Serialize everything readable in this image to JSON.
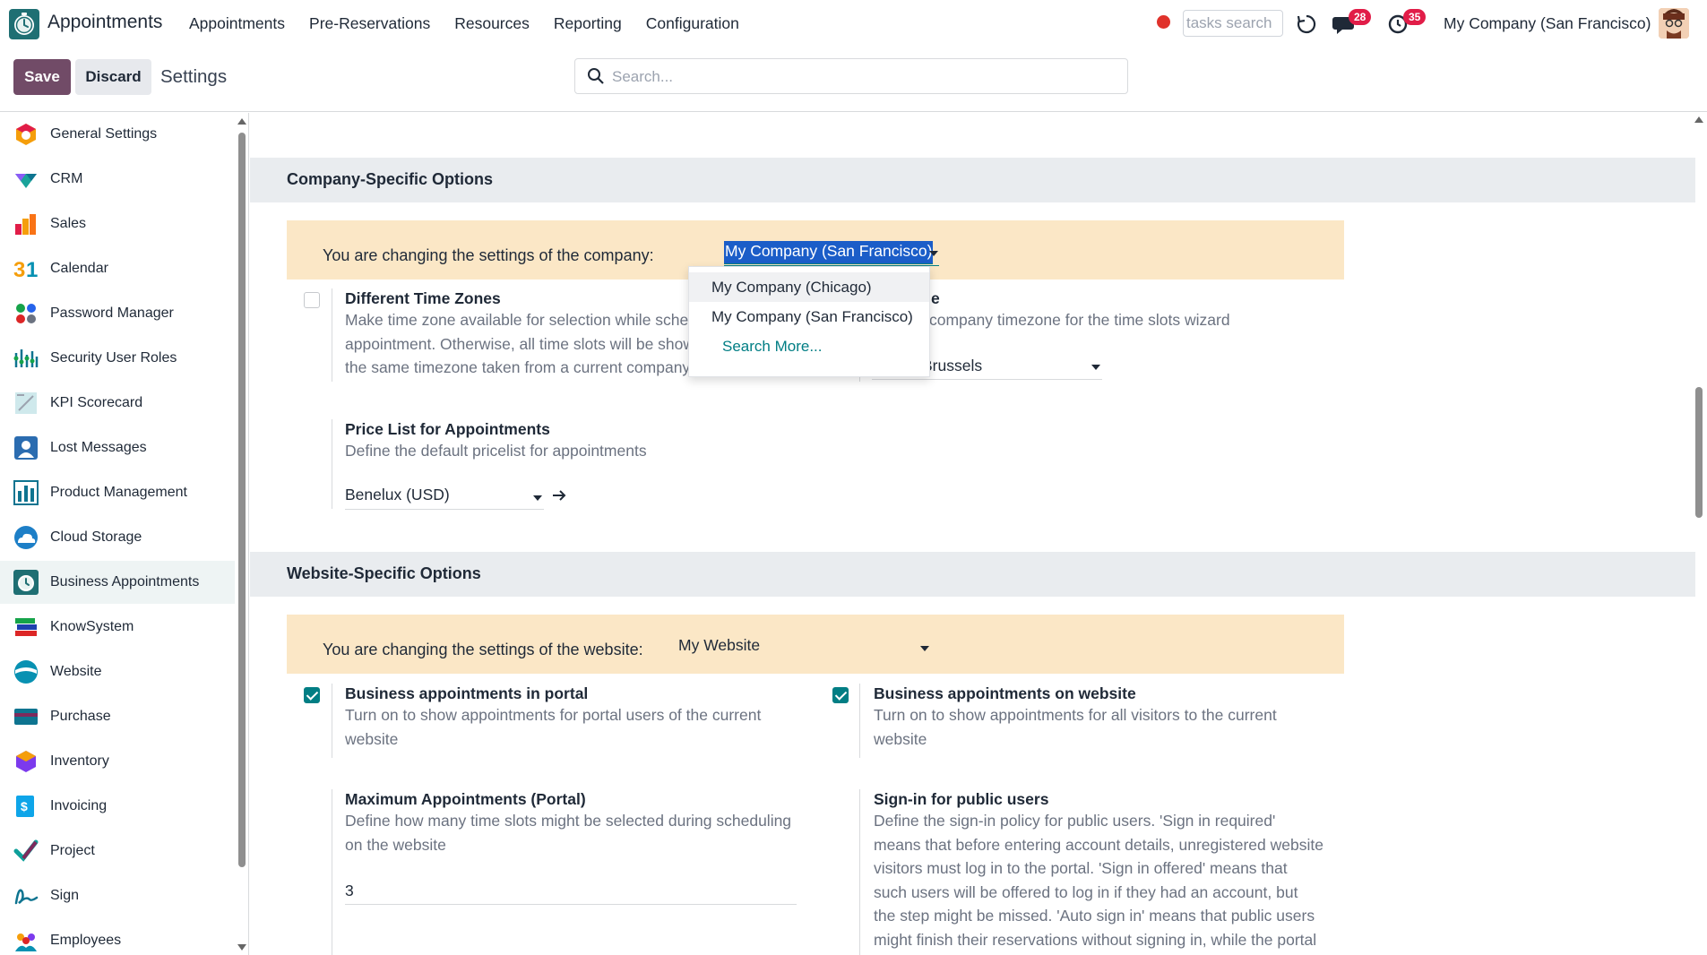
{
  "topbar": {
    "app_name": "Appointments",
    "menu": [
      "Appointments",
      "Pre-Reservations",
      "Resources",
      "Reporting",
      "Configuration"
    ],
    "tasks_search_placeholder": "tasks search",
    "messages_count": "28",
    "activities_count": "35",
    "company": "My Company (San Francisco)"
  },
  "control_panel": {
    "save_label": "Save",
    "discard_label": "Discard",
    "title": "Settings",
    "search_placeholder": "Search..."
  },
  "sidebar": {
    "items": [
      {
        "label": "General Settings",
        "icon": "general-settings-icon"
      },
      {
        "label": "CRM",
        "icon": "crm-icon"
      },
      {
        "label": "Sales",
        "icon": "sales-icon"
      },
      {
        "label": "Calendar",
        "icon": "calendar-icon"
      },
      {
        "label": "Password Manager",
        "icon": "password-manager-icon"
      },
      {
        "label": "Security User Roles",
        "icon": "security-user-roles-icon"
      },
      {
        "label": "KPI Scorecard",
        "icon": "kpi-scorecard-icon"
      },
      {
        "label": "Lost Messages",
        "icon": "lost-messages-icon"
      },
      {
        "label": "Product Management",
        "icon": "product-management-icon"
      },
      {
        "label": "Cloud Storage",
        "icon": "cloud-storage-icon"
      },
      {
        "label": "Business Appointments",
        "icon": "business-appointments-icon",
        "active": true
      },
      {
        "label": "KnowSystem",
        "icon": "knowsystem-icon"
      },
      {
        "label": "Website",
        "icon": "website-icon"
      },
      {
        "label": "Purchase",
        "icon": "purchase-icon"
      },
      {
        "label": "Inventory",
        "icon": "inventory-icon"
      },
      {
        "label": "Invoicing",
        "icon": "invoicing-icon"
      },
      {
        "label": "Project",
        "icon": "project-icon"
      },
      {
        "label": "Sign",
        "icon": "sign-icon"
      },
      {
        "label": "Employees",
        "icon": "employees-icon"
      }
    ]
  },
  "company_section": {
    "heading": "Company-Specific Options",
    "banner_label": "You are changing the settings of the company:",
    "selected_company": "My Company (San Francisco)",
    "dropdown_options": [
      "My Company (Chicago)",
      "My Company (San Francisco)",
      "Search More..."
    ],
    "time_zones": {
      "title": "Different Time Zones",
      "desc_lines": [
        "Make time zone available for selection while sche",
        "appointment. Otherwise, all time slots will be show",
        "the same timezone taken from a current company"
      ],
      "checked": false
    },
    "timezone": {
      "title_fragment": "e",
      "desc_fragment": "company timezone for the time slots wizard",
      "value_fragment": "Brussels"
    },
    "pricelist": {
      "title": "Price List for Appointments",
      "desc": "Define the default pricelist for appointments",
      "value": "Benelux (USD)"
    }
  },
  "website_section": {
    "heading": "Website-Specific Options",
    "banner_label": "You are changing the settings of the website:",
    "selected_website": "My Website",
    "portal": {
      "title": "Business appointments in portal",
      "desc_lines": [
        "Turn on to show appointments for portal users of the current",
        "website"
      ],
      "checked": true
    },
    "website": {
      "title": "Business appointments on website",
      "desc_lines": [
        "Turn on to show appointments for all visitors to the current",
        "website"
      ],
      "checked": true
    },
    "max_appointments": {
      "title": "Maximum Appointments (Portal)",
      "desc_lines": [
        "Define how many time slots might be selected during scheduling",
        "on the website"
      ],
      "value": "3"
    },
    "sign_in": {
      "title": "Sign-in for public users",
      "desc_lines": [
        "Define the sign-in policy for public users. 'Sign in required'",
        "means that before entering account details, unregistered website",
        "visitors must log in to the portal. 'Sign in offered' means that",
        "such users will be offered to log in if they had an account, but",
        "the step might be missed. 'Auto sign in' means that public users",
        "might finish their reservations without signing in, while the portal"
      ]
    }
  },
  "colors": {
    "brand": "#714b67",
    "accent": "#017e84",
    "banner": "#fbe7c6",
    "section": "#e9ecef"
  }
}
